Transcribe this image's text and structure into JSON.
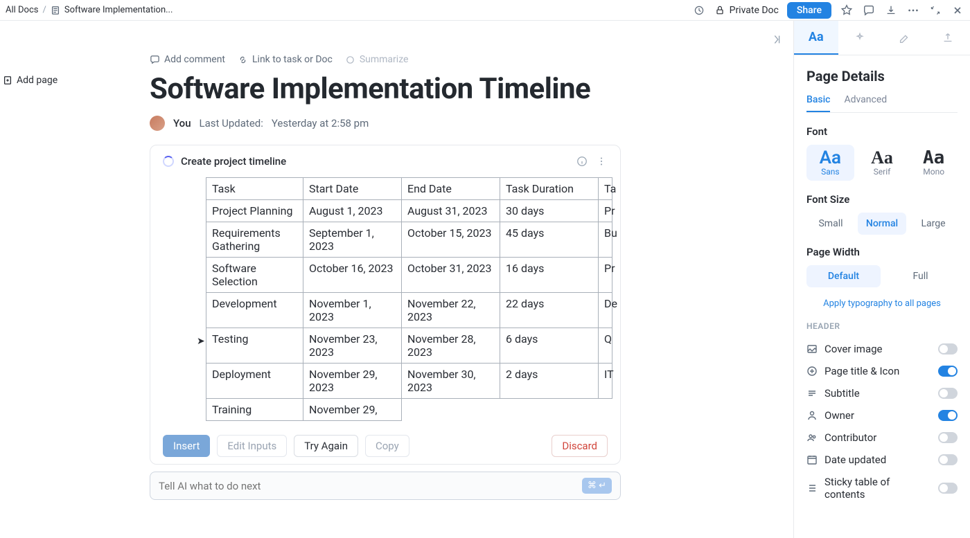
{
  "breadcrumb": {
    "root": "All Docs",
    "doc": "Software Implementation..."
  },
  "topbar": {
    "privacy": "Private Doc",
    "share": "Share"
  },
  "add_page": "Add page",
  "doc_actions": {
    "comment": "Add comment",
    "link": "Link to task or Doc",
    "summarize": "Summarize"
  },
  "title": "Software Implementation Timeline",
  "meta": {
    "author": "You",
    "updated_label": "Last Updated:",
    "updated_value": "Yesterday at 2:58 pm"
  },
  "ai": {
    "prompt_title": "Create project timeline",
    "headers": [
      "Task",
      "Start Date",
      "End Date",
      "Task Duration",
      "Ta"
    ],
    "rows": [
      [
        "Project Planning",
        "August 1, 2023",
        "August 31, 2023",
        "30 days",
        "Pr"
      ],
      [
        "Requirements Gathering",
        "September 1, 2023",
        "October 15, 2023",
        "45 days",
        "Bu"
      ],
      [
        "Software Selection",
        "October 16, 2023",
        "October 31, 2023",
        "16 days",
        "Pr"
      ],
      [
        "Development",
        "November 1, 2023",
        "November 22, 2023",
        "22 days",
        "De"
      ],
      [
        "Testing",
        "November 23, 2023",
        "November 28, 2023",
        "6 days",
        "Q"
      ],
      [
        "Deployment",
        "November 29, 2023",
        "November 30, 2023",
        "2 days",
        "IT"
      ],
      [
        "Training",
        "November 29,",
        "",
        "",
        ""
      ]
    ],
    "buttons": {
      "insert": "Insert",
      "edit_inputs": "Edit Inputs",
      "try_again": "Try Again",
      "copy": "Copy",
      "discard": "Discard"
    },
    "input_placeholder": "Tell AI what to do next",
    "shortcut": "⌘ ↵"
  },
  "rpanel": {
    "title": "Page Details",
    "tabs": {
      "basic": "Basic",
      "advanced": "Advanced"
    },
    "font_label": "Font",
    "fonts": {
      "sans": "Sans",
      "serif": "Serif",
      "mono": "Mono"
    },
    "font_size_label": "Font Size",
    "sizes": {
      "small": "Small",
      "normal": "Normal",
      "large": "Large"
    },
    "width_label": "Page Width",
    "widths": {
      "default": "Default",
      "full": "Full"
    },
    "apply_all": "Apply typography to all pages",
    "header_section": "HEADER",
    "toggles": {
      "cover": "Cover image",
      "pagetitle": "Page title & Icon",
      "subtitle": "Subtitle",
      "owner": "Owner",
      "contributor": "Contributor",
      "dateupdated": "Date updated",
      "toc": "Sticky table of contents"
    }
  }
}
